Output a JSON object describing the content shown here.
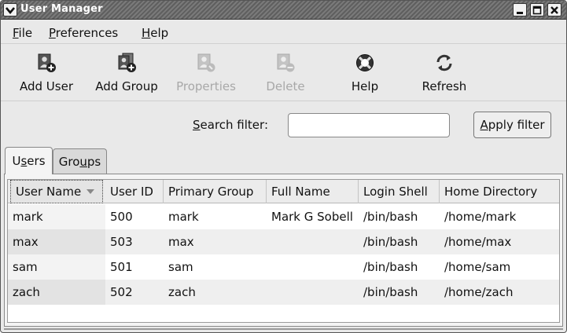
{
  "window": {
    "title": "User Manager",
    "icons": {
      "menu": "chevron-down-icon",
      "minimize": "minimize-icon",
      "maximize": "maximize-icon",
      "close": "close-icon"
    }
  },
  "menubar": {
    "items": [
      {
        "label_mnemonic": "F",
        "label_rest": "ile"
      },
      {
        "label_mnemonic": "P",
        "label_rest": "references"
      },
      {
        "label_mnemonic": "H",
        "label_rest": "elp"
      }
    ]
  },
  "toolbar": {
    "add_user": {
      "label": "Add User",
      "icon": "add-user-icon"
    },
    "add_group": {
      "label": "Add Group",
      "icon": "add-group-icon"
    },
    "properties": {
      "label": "Properties",
      "icon": "properties-icon",
      "disabled": true
    },
    "delete": {
      "label": "Delete",
      "icon": "delete-icon",
      "disabled": true
    },
    "help": {
      "label": "Help",
      "icon": "lifebuoy-icon"
    },
    "refresh": {
      "label": "Refresh",
      "icon": "refresh-icon"
    }
  },
  "search": {
    "label_mnemonic": "S",
    "label_rest": "earch filter:",
    "value": "",
    "apply_mnemonic": "A",
    "apply_rest": "pply filter"
  },
  "tabs": [
    {
      "label_pre": "U",
      "label_mnemonic": "s",
      "label_rest": "ers",
      "active": true
    },
    {
      "label_pre": "Gro",
      "label_mnemonic": "u",
      "label_rest": "ps",
      "active": false
    }
  ],
  "table": {
    "columns": [
      "User Name",
      "User ID",
      "Primary Group",
      "Full Name",
      "Login Shell",
      "Home Directory"
    ],
    "sorted_column": "User Name",
    "rows": [
      [
        "mark",
        "500",
        "mark",
        "Mark G Sobell",
        "/bin/bash",
        "/home/mark"
      ],
      [
        "max",
        "503",
        "max",
        "",
        "/bin/bash",
        "/home/max"
      ],
      [
        "sam",
        "501",
        "sam",
        "",
        "/bin/bash",
        "/home/sam"
      ],
      [
        "zach",
        "502",
        "zach",
        "",
        "/bin/bash",
        "/home/zach"
      ]
    ]
  }
}
